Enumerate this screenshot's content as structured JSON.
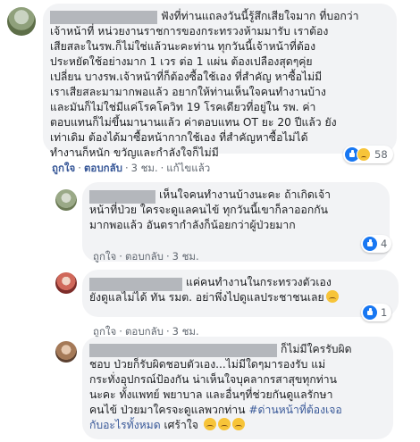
{
  "comments": [
    {
      "lines": [
        "ฟังที่ท่านแถลงวันนี้รู้สึกเสียใจมาก ที่บอกว่า",
        "เจ้าหน้าที่ หน่วยงานราชการของกระทรวงห้ามมารับ เราต้อง",
        "เสียสละในรพ.ก็ไม่ใช่แล้วนะคะท่าน ทุกวันนี้เจ้าหน้าที่ต้อง",
        "ประหยัดใช้อย่างมาก 1 เวร ต่อ 1 แผ่น ต้องเปลืองสุดๆคุ่ย",
        "เปลี่ยน บางรพ.เจ้าหน้าที่ก็ต้องซื้อใช้เอง ที่สำคัญ หาซื้อไม่มี",
        "เราเสียสละมามากพอแล้ว อยากให้ท่านเห็นใจคนทำงานบ้าง",
        "และมันก็ไม่ใช่มีแค่โรคโควิท 19 โรคเดียวที่อยู่ใน รพ. ค่า",
        "ตอบแทนก็ไม่ขึ้นมานานแล้ว ค่าตอบแทน OT ยะ 20 ปีแล้ว ยัง",
        "เท่าเดิม ต้องได้มาซื้อหน้ากากใช้เอง ที่สำคัญหาซื้อไม่ได้",
        "ทำงานก็หนัก ขวัญและกำลังใจก็ไม่มี"
      ],
      "actions": {
        "like": "ถูกใจ",
        "reply": "ตอบกลับ",
        "time": "3 ชม.",
        "edited": "แก้ไขแล้ว"
      },
      "reactions": {
        "count": "58",
        "icons": [
          "like-icon",
          "sad-icon"
        ]
      }
    },
    {
      "lines": [
        "เห็นใจคนทำงานบ้างนะคะ ถ้าเกิดเจ้า",
        "หน้าที่ป่วย ใครจะดูแลคนไข้ ทุกวันนี้เขาก็ลาออกกัน",
        "มากพอแล้ว อันตรากำลังก็น้อยกว่าผู้ป่วยมาก"
      ],
      "actions": {
        "like": "ถูกใจ",
        "reply": "ตอบกลับ",
        "time": "3 ชม."
      },
      "reactions": {
        "count": "4",
        "icons": [
          "like-icon"
        ]
      }
    },
    {
      "lines": [
        "แค่คนทำงานในกระทรวงตัวเอง",
        "ยังดูแลไม่ได้ ทัน รมต. อย่าพึ่งไปดูแลประชาชนเลย"
      ],
      "actions": {
        "like": "ถูกใจ",
        "reply": "ตอบกลับ",
        "time": "3 ชม."
      },
      "reactions": {
        "count": "1",
        "icons": [
          "like-icon"
        ]
      }
    },
    {
      "lines": [
        "ก็ไม่มีใครรับผิด",
        "ชอบ ป่วยก็รับผิดชอบตัวเอง...ไม่มีใดๆมารองรับ แม่",
        "กระทั่งอุปกรณ์ป้องกัน น่าเห็นใจบุคลากรสาสุขทุกท่าน",
        "นะคะ ทั้งแพทย์ พยาบาล และอื่นๆที่ช่วยกันดูแลรักษา",
        "คนไข้ ป่วยมาใครจะดูแลพวกท่าน",
        "กับอะไรทั้งหมด",
        "เศร้าใจ"
      ],
      "hashtag": {
        "part1": "#ด่านหน้าที่ต้องเจอ",
        "part2": "กับอะไรทั้งหมด"
      },
      "tail": "เศร้าใจ"
    }
  ]
}
